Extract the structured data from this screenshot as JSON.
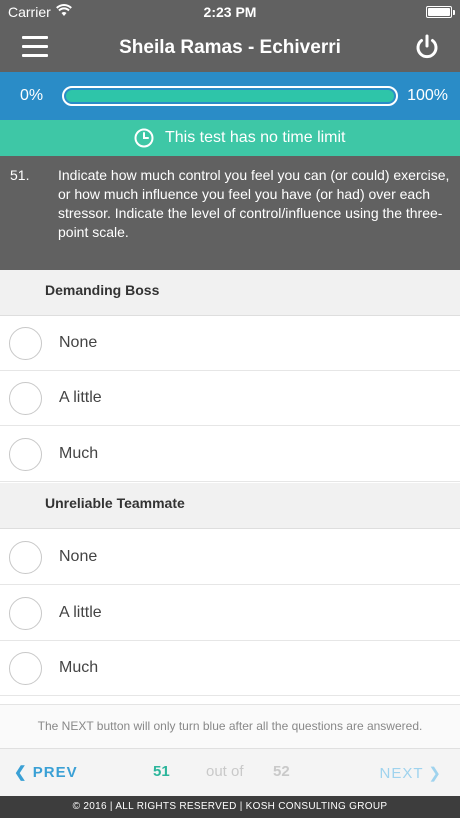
{
  "status_bar": {
    "carrier": "Carrier",
    "time": "2:23 PM"
  },
  "header": {
    "title": "Sheila Ramas - Echiverri"
  },
  "progress": {
    "left_label": "0%",
    "right_label": "100%",
    "fill_fraction": 1.0,
    "fill_color": "#2ec5a9"
  },
  "time_notice": {
    "text": "This test has no time limit"
  },
  "question": {
    "number": "51.",
    "text": "Indicate how much control you feel you can (or could) exercise, or how much influence you feel you have (or had) over each stressor. Indicate the level of control/influence using the three-point scale."
  },
  "sections": [
    {
      "title": "Demanding Boss",
      "options": [
        "None",
        "A little",
        "Much"
      ]
    },
    {
      "title": "Unreliable Teammate",
      "options": [
        "None",
        "A little",
        "Much"
      ]
    }
  ],
  "note": "The NEXT button will only turn blue after all the questions are answered.",
  "pager": {
    "prev_label": "PREV",
    "current": "51",
    "of_label": "out of",
    "total": "52",
    "next_label": "NEXT"
  },
  "footer": "© 2016  |  ALL RIGHTS RESERVED  |  KOSH CONSULTING GROUP",
  "colors": {
    "header": "#616161",
    "progress_bar": "#2a8cc7",
    "time_bar": "#3ec7a6",
    "link": "#3aa0d5"
  }
}
